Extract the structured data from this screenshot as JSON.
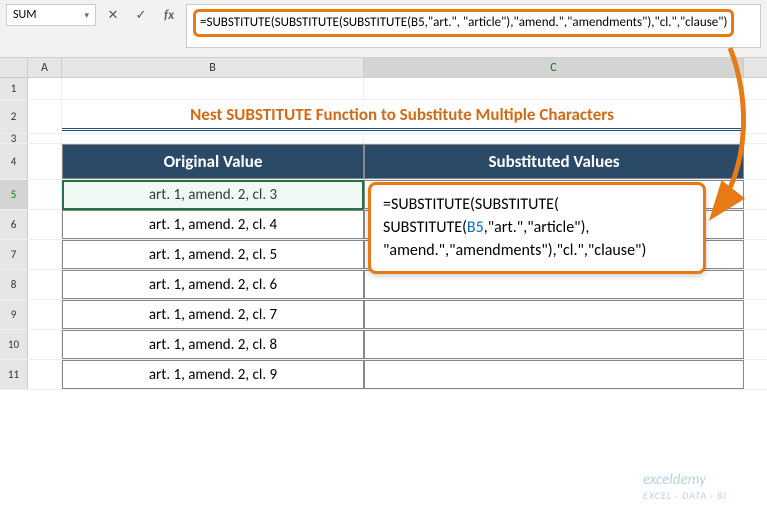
{
  "namebox": {
    "value": "SUM"
  },
  "formula_bar": {
    "text": "=SUBSTITUTE(SUBSTITUTE(SUBSTITUTE(B5,\"art.\", \"article\"),\"amend.\",\"amendments\"),\"cl.\",\"clause\")"
  },
  "columns": {
    "A": "A",
    "B": "B",
    "C": "C"
  },
  "rows": {
    "1": "1",
    "2": "2",
    "3": "3",
    "4": "4",
    "5": "5",
    "6": "6",
    "7": "7",
    "8": "8",
    "9": "9",
    "10": "10",
    "11": "11"
  },
  "title": "Nest SUBSTITUTE Function to Substitute Multiple Characters",
  "headers": {
    "b": "Original Value",
    "c": "Substituted Values"
  },
  "data": {
    "b5": "art. 1, amend. 2, cl. 3",
    "b6": "art. 1, amend. 2, cl. 4",
    "b7": "art. 1, amend. 2, cl. 5",
    "b8": "art. 1, amend. 2, cl. 6",
    "b9": "art. 1, amend. 2, cl. 7",
    "b10": "art. 1, amend. 2, cl. 8",
    "b11": "art. 1, amend. 2, cl. 9"
  },
  "annotation": {
    "prefix": "=SUBSTITUTE(SUBSTITUTE(",
    "line2a": "SUBSTITUTE(",
    "ref": "B5",
    "line2b": ",\"art.\",\"article\"),",
    "line3": "\"amend.\",\"amendments\"),\"cl.\",\"clause\")"
  },
  "watermark": {
    "brand": "exceldemy",
    "tag": "EXCEL · DATA · BI"
  },
  "icons": {
    "fx": "fx",
    "cancel": "✕",
    "enter": "✓",
    "dropdown": "▾"
  }
}
